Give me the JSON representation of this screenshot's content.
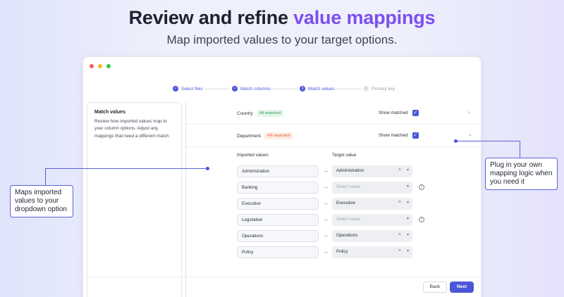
{
  "hero": {
    "title_plain": "Review and refine ",
    "title_accent": "value mappings",
    "subtitle": "Map imported values to your target options."
  },
  "colors": {
    "accent_purple": "#7c4ef0",
    "primary": "#4c56d9",
    "dot_red": "#f25f58",
    "dot_yellow": "#f5b82e",
    "dot_green": "#3ec34b"
  },
  "steps": [
    {
      "label": "Select files",
      "state": "done",
      "marker": "✓"
    },
    {
      "label": "Match columns",
      "state": "done",
      "marker": "✓"
    },
    {
      "label": "Match values",
      "state": "current",
      "marker": "3"
    },
    {
      "label": "Primary key",
      "state": "upcoming",
      "marker": "4"
    }
  ],
  "sidebar": {
    "title": "Match values",
    "description": "Review how imported values map to your column options. Adjust any mappings that need a different match."
  },
  "columns": {
    "country": {
      "name": "Country",
      "badge": "All matched",
      "show_matched": "Show matched"
    },
    "department": {
      "name": "Department",
      "badge": "4/6 matched",
      "show_matched": "Show matched"
    }
  },
  "table": {
    "header_imported": "Imported values",
    "header_target": "Target value",
    "rows": [
      {
        "source": "Administration",
        "target": "Administration",
        "matched": true
      },
      {
        "source": "Banking",
        "target": "Select value",
        "matched": false
      },
      {
        "source": "Executive",
        "target": "Executive",
        "matched": true
      },
      {
        "source": "Legislative",
        "target": "Select value",
        "matched": false
      },
      {
        "source": "Operations",
        "target": "Operations",
        "matched": true
      },
      {
        "source": "Policy",
        "target": "Policy",
        "matched": true
      }
    ]
  },
  "footer": {
    "back_label": "Back",
    "next_label": "Next"
  },
  "callouts": {
    "left": "Maps imported values to your dropdown option",
    "right": "Plug in your own mapping logic when you need it"
  }
}
